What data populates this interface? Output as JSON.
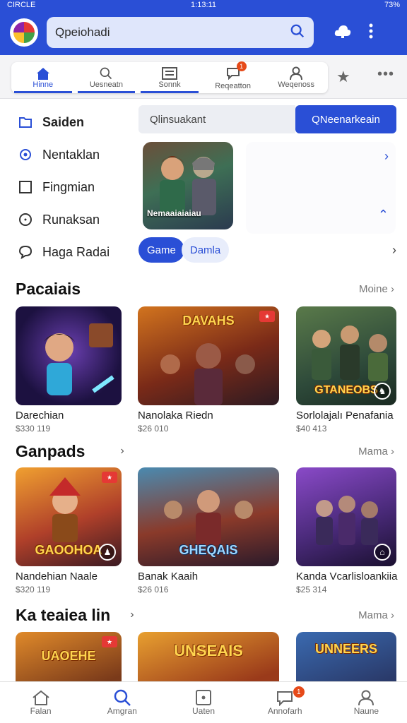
{
  "status_bar": {
    "carrier": "CIRCLE",
    "time": "1:13:11",
    "battery": "73%"
  },
  "header": {
    "search_placeholder": "Qpeiohadi",
    "logo_icon": "app-logo-icon",
    "right_icons": [
      "cloud-icon",
      "more-vertical-icon"
    ]
  },
  "tabs": [
    {
      "label": "Hinne",
      "icon": "home-icon",
      "active": false
    },
    {
      "label": "Uesneatn",
      "icon": "search-icon",
      "active": false
    },
    {
      "label": "Sonnk",
      "icon": "list-icon",
      "active": true
    },
    {
      "label": "Reqeatton",
      "icon": "chat-icon",
      "active": false,
      "badge": "1"
    },
    {
      "label": "Weqenoss",
      "icon": "user-icon",
      "active": false
    }
  ],
  "sidebar": {
    "items": [
      {
        "label": "Saiden",
        "icon": "folder-icon",
        "active": true
      },
      {
        "label": "Nentaklan",
        "icon": "gear-icon",
        "active": false
      },
      {
        "label": "Fingmian",
        "icon": "square-icon",
        "active": false
      },
      {
        "label": "Runaksan",
        "icon": "compass-icon",
        "active": false
      },
      {
        "label": "Haga Radai",
        "icon": "speech-bubble-icon",
        "active": false
      }
    ]
  },
  "filter": {
    "input_placeholder": "Qlinsuakant",
    "button_label": "QNeenarkeain"
  },
  "feature": {
    "card_label": "Nemaaiaiaiau"
  },
  "pills": {
    "active": "Game",
    "inactive": "Damla"
  },
  "sections": [
    {
      "title": "Pacaiais",
      "more": "Moine",
      "games": [
        {
          "name": "Darechian",
          "price": "$330 119"
        },
        {
          "name": "Nanolaka Riedn",
          "price": "$26 010"
        },
        {
          "name": "Sorlolajalı Penafania",
          "price": "$40 413"
        }
      ]
    },
    {
      "title": "Ganpads",
      "more": "Mama",
      "games": [
        {
          "name": "Nandehian Naale",
          "price": "$320 119"
        },
        {
          "name": "Banak Kaaih",
          "price": "$26 016"
        },
        {
          "name": "Kanda Vcarlisloankiia",
          "price": "$25 314"
        }
      ]
    },
    {
      "title": "Ka teaiea lin",
      "more": "Mama",
      "games": [
        {
          "name": "",
          "price": ""
        },
        {
          "name": "",
          "price": ""
        },
        {
          "name": "",
          "price": ""
        }
      ]
    }
  ],
  "thumb_art": [
    "",
    "DAVAHS",
    "GTANEOBS",
    "GAOOHOA",
    "GHEQAIS",
    "",
    "UAOEHE",
    "UNSEAIS",
    "UNNEERS"
  ],
  "bottom_nav": [
    {
      "label": "Falan",
      "icon": "home-icon"
    },
    {
      "label": "Amgran",
      "icon": "search-icon"
    },
    {
      "label": "Uaten",
      "icon": "square-dot-icon"
    },
    {
      "label": "Annofarh",
      "icon": "chat-icon",
      "badge": "1"
    },
    {
      "label": "Naune",
      "icon": "user-icon"
    }
  ],
  "colors": {
    "primary": "#2a4fd6",
    "badge": "#e64a19",
    "background": "#ffffff"
  }
}
